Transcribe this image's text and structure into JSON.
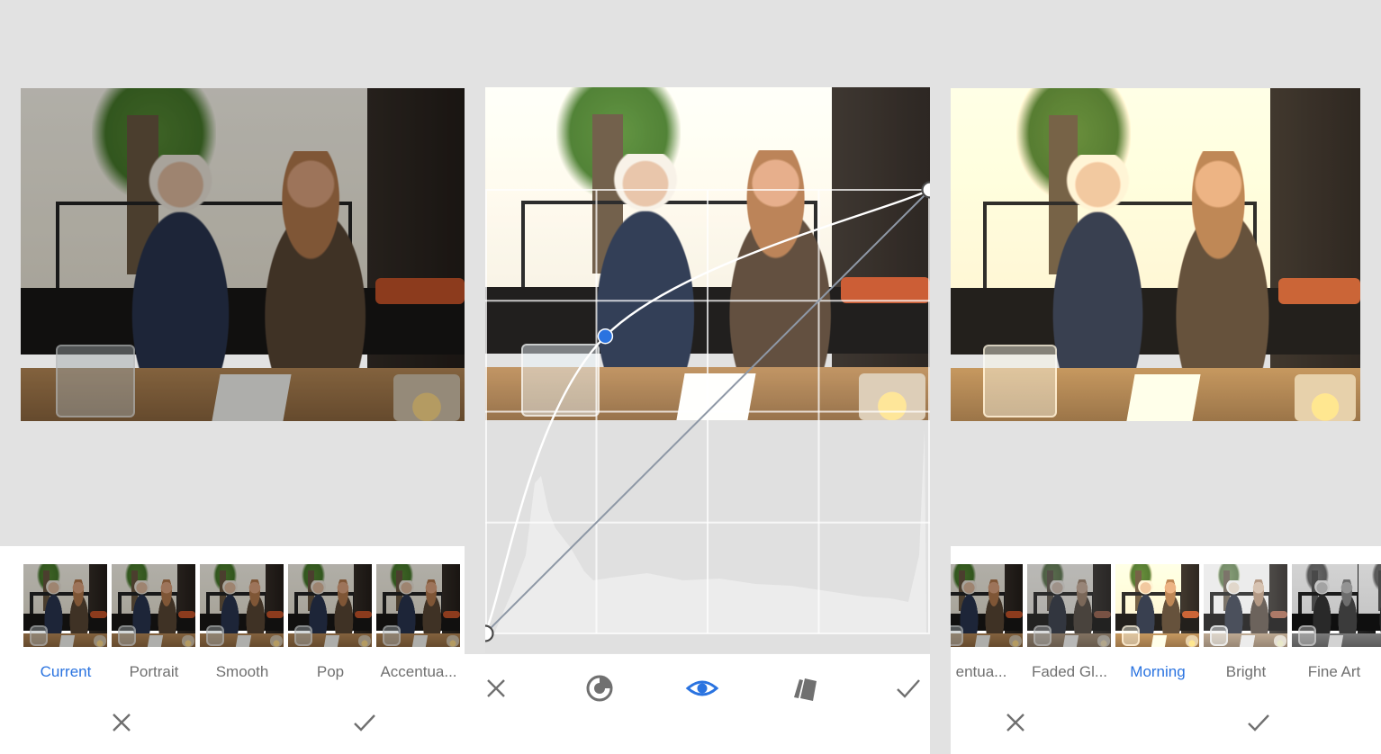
{
  "left_panel": {
    "filters": [
      {
        "label": "Current",
        "active": true,
        "tone": "current"
      },
      {
        "label": "Portrait",
        "active": false,
        "tone": "current"
      },
      {
        "label": "Smooth",
        "active": false,
        "tone": "current"
      },
      {
        "label": "Pop",
        "active": false,
        "tone": "current"
      },
      {
        "label": "Accentua...",
        "active": false,
        "tone": "current"
      }
    ],
    "cancel_icon": "close-icon",
    "apply_icon": "checkmark-icon"
  },
  "middle_panel": {
    "tool": "Curves",
    "toolbar": {
      "cancel_icon": "close-icon",
      "rgb_icon": "color-channel-icon",
      "compare_icon": "eye-icon",
      "presets_icon": "presets-stack-icon",
      "apply_icon": "checkmark-icon"
    },
    "curve_points": [
      {
        "input": 0,
        "output": 0,
        "selected": false
      },
      {
        "input": 0.27,
        "output": 0.67,
        "selected": true
      },
      {
        "input": 1,
        "output": 1,
        "selected": false
      }
    ]
  },
  "right_panel": {
    "filters": [
      {
        "label": "entua...",
        "active": false,
        "tone": "current"
      },
      {
        "label": "Faded Gl...",
        "active": false,
        "tone": "faded"
      },
      {
        "label": "Morning",
        "active": true,
        "tone": "morning"
      },
      {
        "label": "Bright",
        "active": false,
        "tone": "brightflt"
      },
      {
        "label": "Fine Art",
        "active": false,
        "tone": "fineart"
      }
    ],
    "cancel_icon": "close-icon",
    "apply_icon": "checkmark-icon"
  },
  "colors": {
    "accent": "#2a73e0",
    "label_gray": "#707070",
    "background": "#e2e2e2"
  }
}
